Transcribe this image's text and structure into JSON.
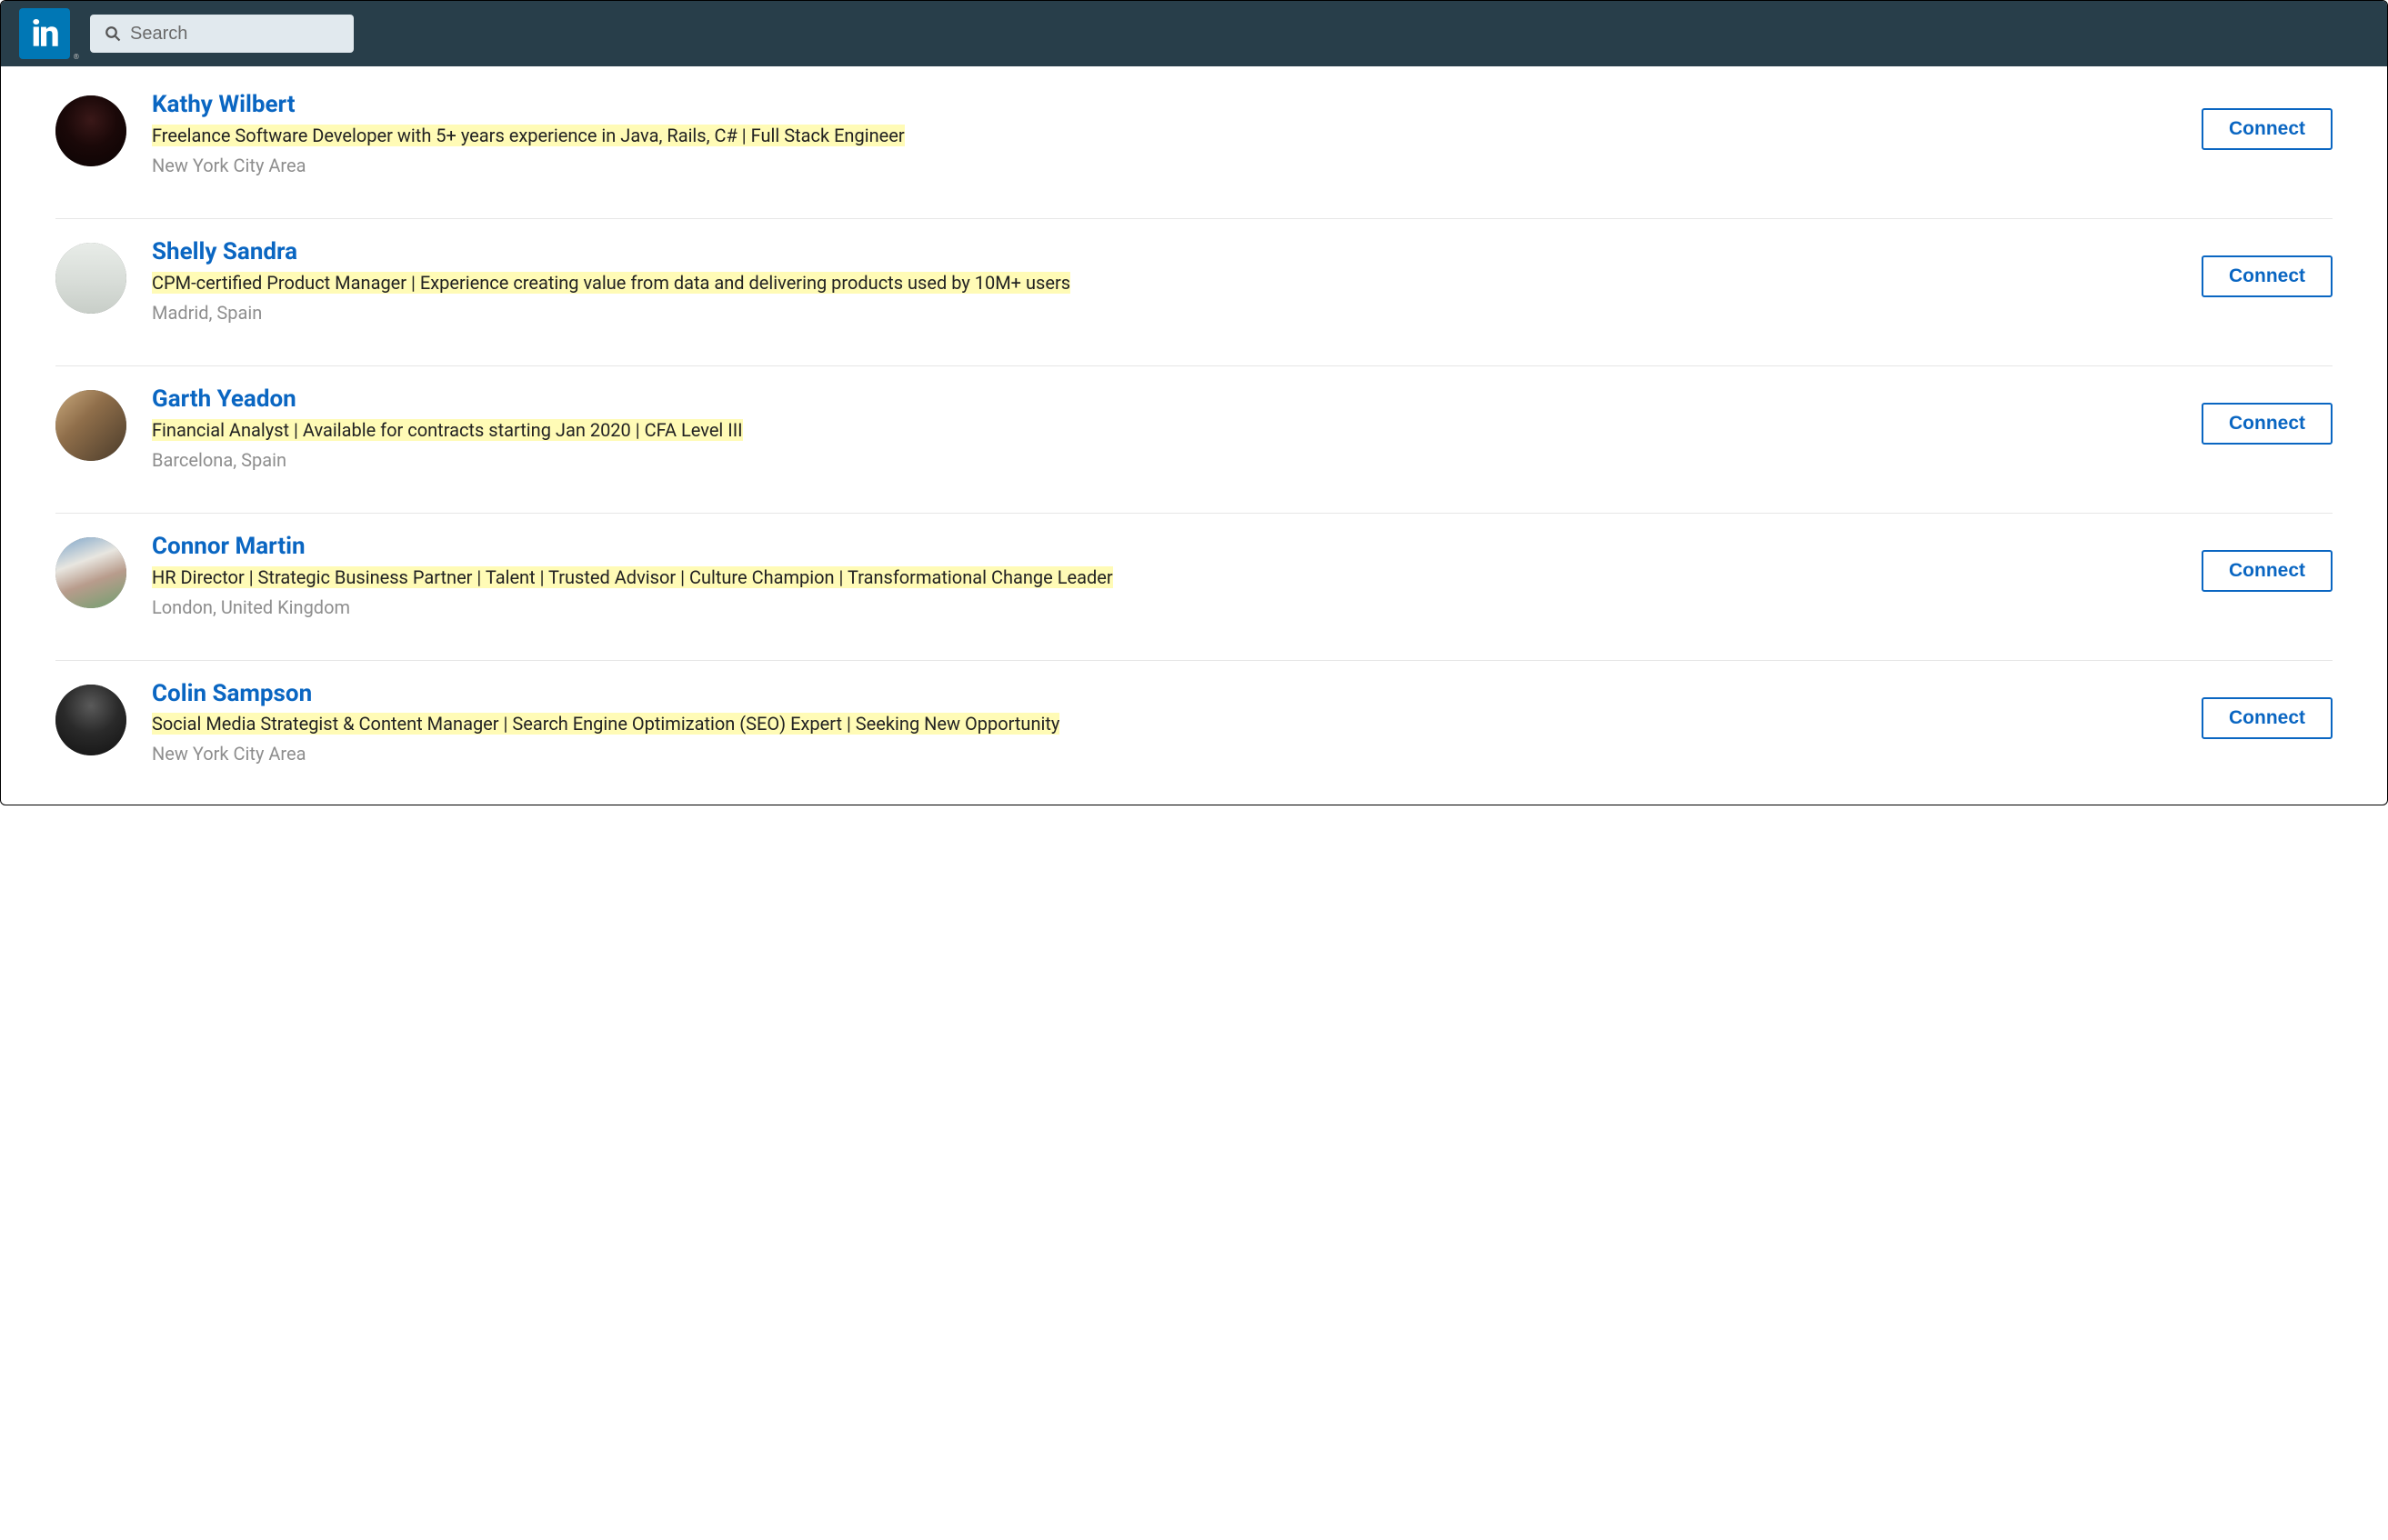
{
  "header": {
    "logo_text": "in",
    "search_placeholder": "Search"
  },
  "connect_label": "Connect",
  "results": [
    {
      "name": "Kathy Wilbert",
      "headline": "Freelance Software Developer with 5+ years experience in Java, Rails, C# | Full Stack Engineer",
      "location": "New York City Area",
      "avatar_bg": "radial-gradient(circle at 50% 35%, #3a1818 0%, #1a0808 45%, #0a0303 100%)"
    },
    {
      "name": "Shelly Sandra",
      "headline": "CPM-certified Product Manager | Experience creating value from data and delivering products used by 10M+ users",
      "location": "Madrid, Spain",
      "avatar_bg": "linear-gradient(180deg, #e8ece8 0%, #d8ddd8 55%, #c8cec8 100%)"
    },
    {
      "name": "Garth Yeadon",
      "headline": "Financial Analyst | Available for contracts starting Jan 2020 | CFA Level III",
      "location": "Barcelona, Spain",
      "avatar_bg": "linear-gradient(135deg, #c9a97d 0%, #8f6e4a 40%, #4a3b2a 100%)"
    },
    {
      "name": "Connor Martin",
      "headline": "HR Director | Strategic Business Partner | Talent | Trusted Advisor | Culture Champion | Transformational Change Leader",
      "location": "London, United Kingdom",
      "avatar_bg": "linear-gradient(160deg, #7aa3c9 0%, #e8e6e0 35%, #b89c8c 60%, #6fa06f 100%)"
    },
    {
      "name": "Colin Sampson",
      "headline": "Social Media Strategist & Content Manager | Search Engine Optimization (SEO) Expert | Seeking New Opportunity",
      "location": "New York City Area",
      "avatar_bg": "radial-gradient(circle at 50% 30%, #5a5a5a 0%, #2a2a2a 45%, #111 100%)"
    }
  ]
}
